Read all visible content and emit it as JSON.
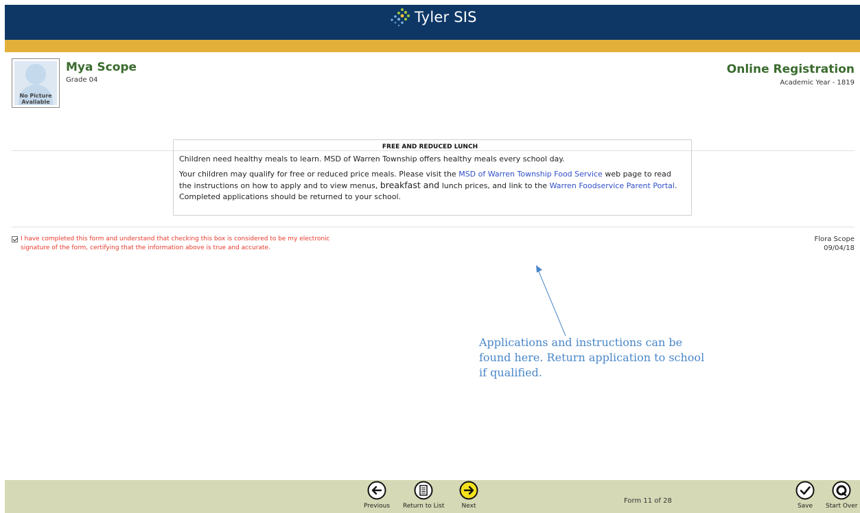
{
  "header": {
    "app_name": "Tyler SIS",
    "brand_color": "#0e3766",
    "accent_color": "#e3b03a"
  },
  "student": {
    "name": "Mya Scope",
    "grade": "Grade 04",
    "avatar_placeholder": "No Picture Available"
  },
  "registration": {
    "title": "Online Registration",
    "academic_year": "Academic Year - 1819"
  },
  "section": {
    "title": "FREE AND REDUCED LUNCH",
    "intro": "Children need healthy meals to learn. MSD of Warren Township offers healthy meals every school day.",
    "p2_a": "Your children may qualify for free or reduced price meals. Please visit the ",
    "link_food_service": "MSD of Warren Township Food Service",
    "p2_b": " web page to read the instructions on how to apply and to view menus, ",
    "p2_big": "breakfast and",
    "p2_c": " lunch prices, and link to the ",
    "link_portal": "Warren Foodservice Parent Portal",
    "p2_d": ".  Completed applications should be returned to your school."
  },
  "acknowledgement": {
    "checked": true,
    "text": "I have completed this form and understand that checking this box is considered to be my electronic signature of the form, certifying that the information above is true and accurate.",
    "signer_name": "Flora Scope",
    "signed_date": "09/04/18"
  },
  "annotation": {
    "text": "Applications and instructions can be found here. Return application to school if qualified."
  },
  "footer": {
    "previous_label": "Previous",
    "return_label": "Return to List",
    "next_label": "Next",
    "form_count": "Form 11 of 28",
    "save_label": "Save",
    "start_over_label": "Start Over"
  }
}
